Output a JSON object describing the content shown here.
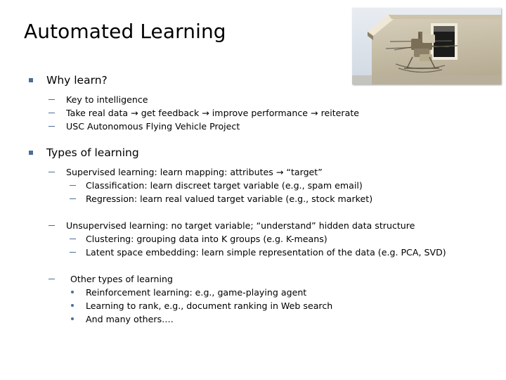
{
  "slide": {
    "title": "Automated Learning",
    "background_color": "#ffffff",
    "text_color": "#000000",
    "bullet_color": "#4a6f96"
  },
  "image": {
    "name": "autonomous-helicopter-photo",
    "alt": "Autonomous flying vehicle (helicopter drone) hovering beside a stucco building with a dark window"
  },
  "content": {
    "section1": {
      "heading": "Why learn?",
      "items": [
        "Key to intelligence",
        "Take real data → get feedback → improve performance → reiterate",
        "USC Autonomous Flying Vehicle Project"
      ]
    },
    "section2": {
      "heading": "Types of learning",
      "supervised": {
        "label": "Supervised learning: learn mapping: attributes → “target”",
        "items": [
          "Classification: learn discreet target variable (e.g., spam email)",
          "Regression: learn real valued target variable (e.g., stock market)"
        ]
      },
      "unsupervised": {
        "label": "Unsupervised learning: no target variable; “understand” hidden data structure",
        "items": [
          "Clustering: grouping data into K groups (e.g. K-means)",
          "Latent space embedding: learn simple representation of the data (e.g. PCA, SVD)"
        ]
      },
      "other": {
        "label": "Other types of learning",
        "items": [
          "Reinforcement learning: e.g., game-playing agent",
          "Learning to rank, e.g., document ranking in Web search",
          "And many others…."
        ]
      }
    }
  }
}
